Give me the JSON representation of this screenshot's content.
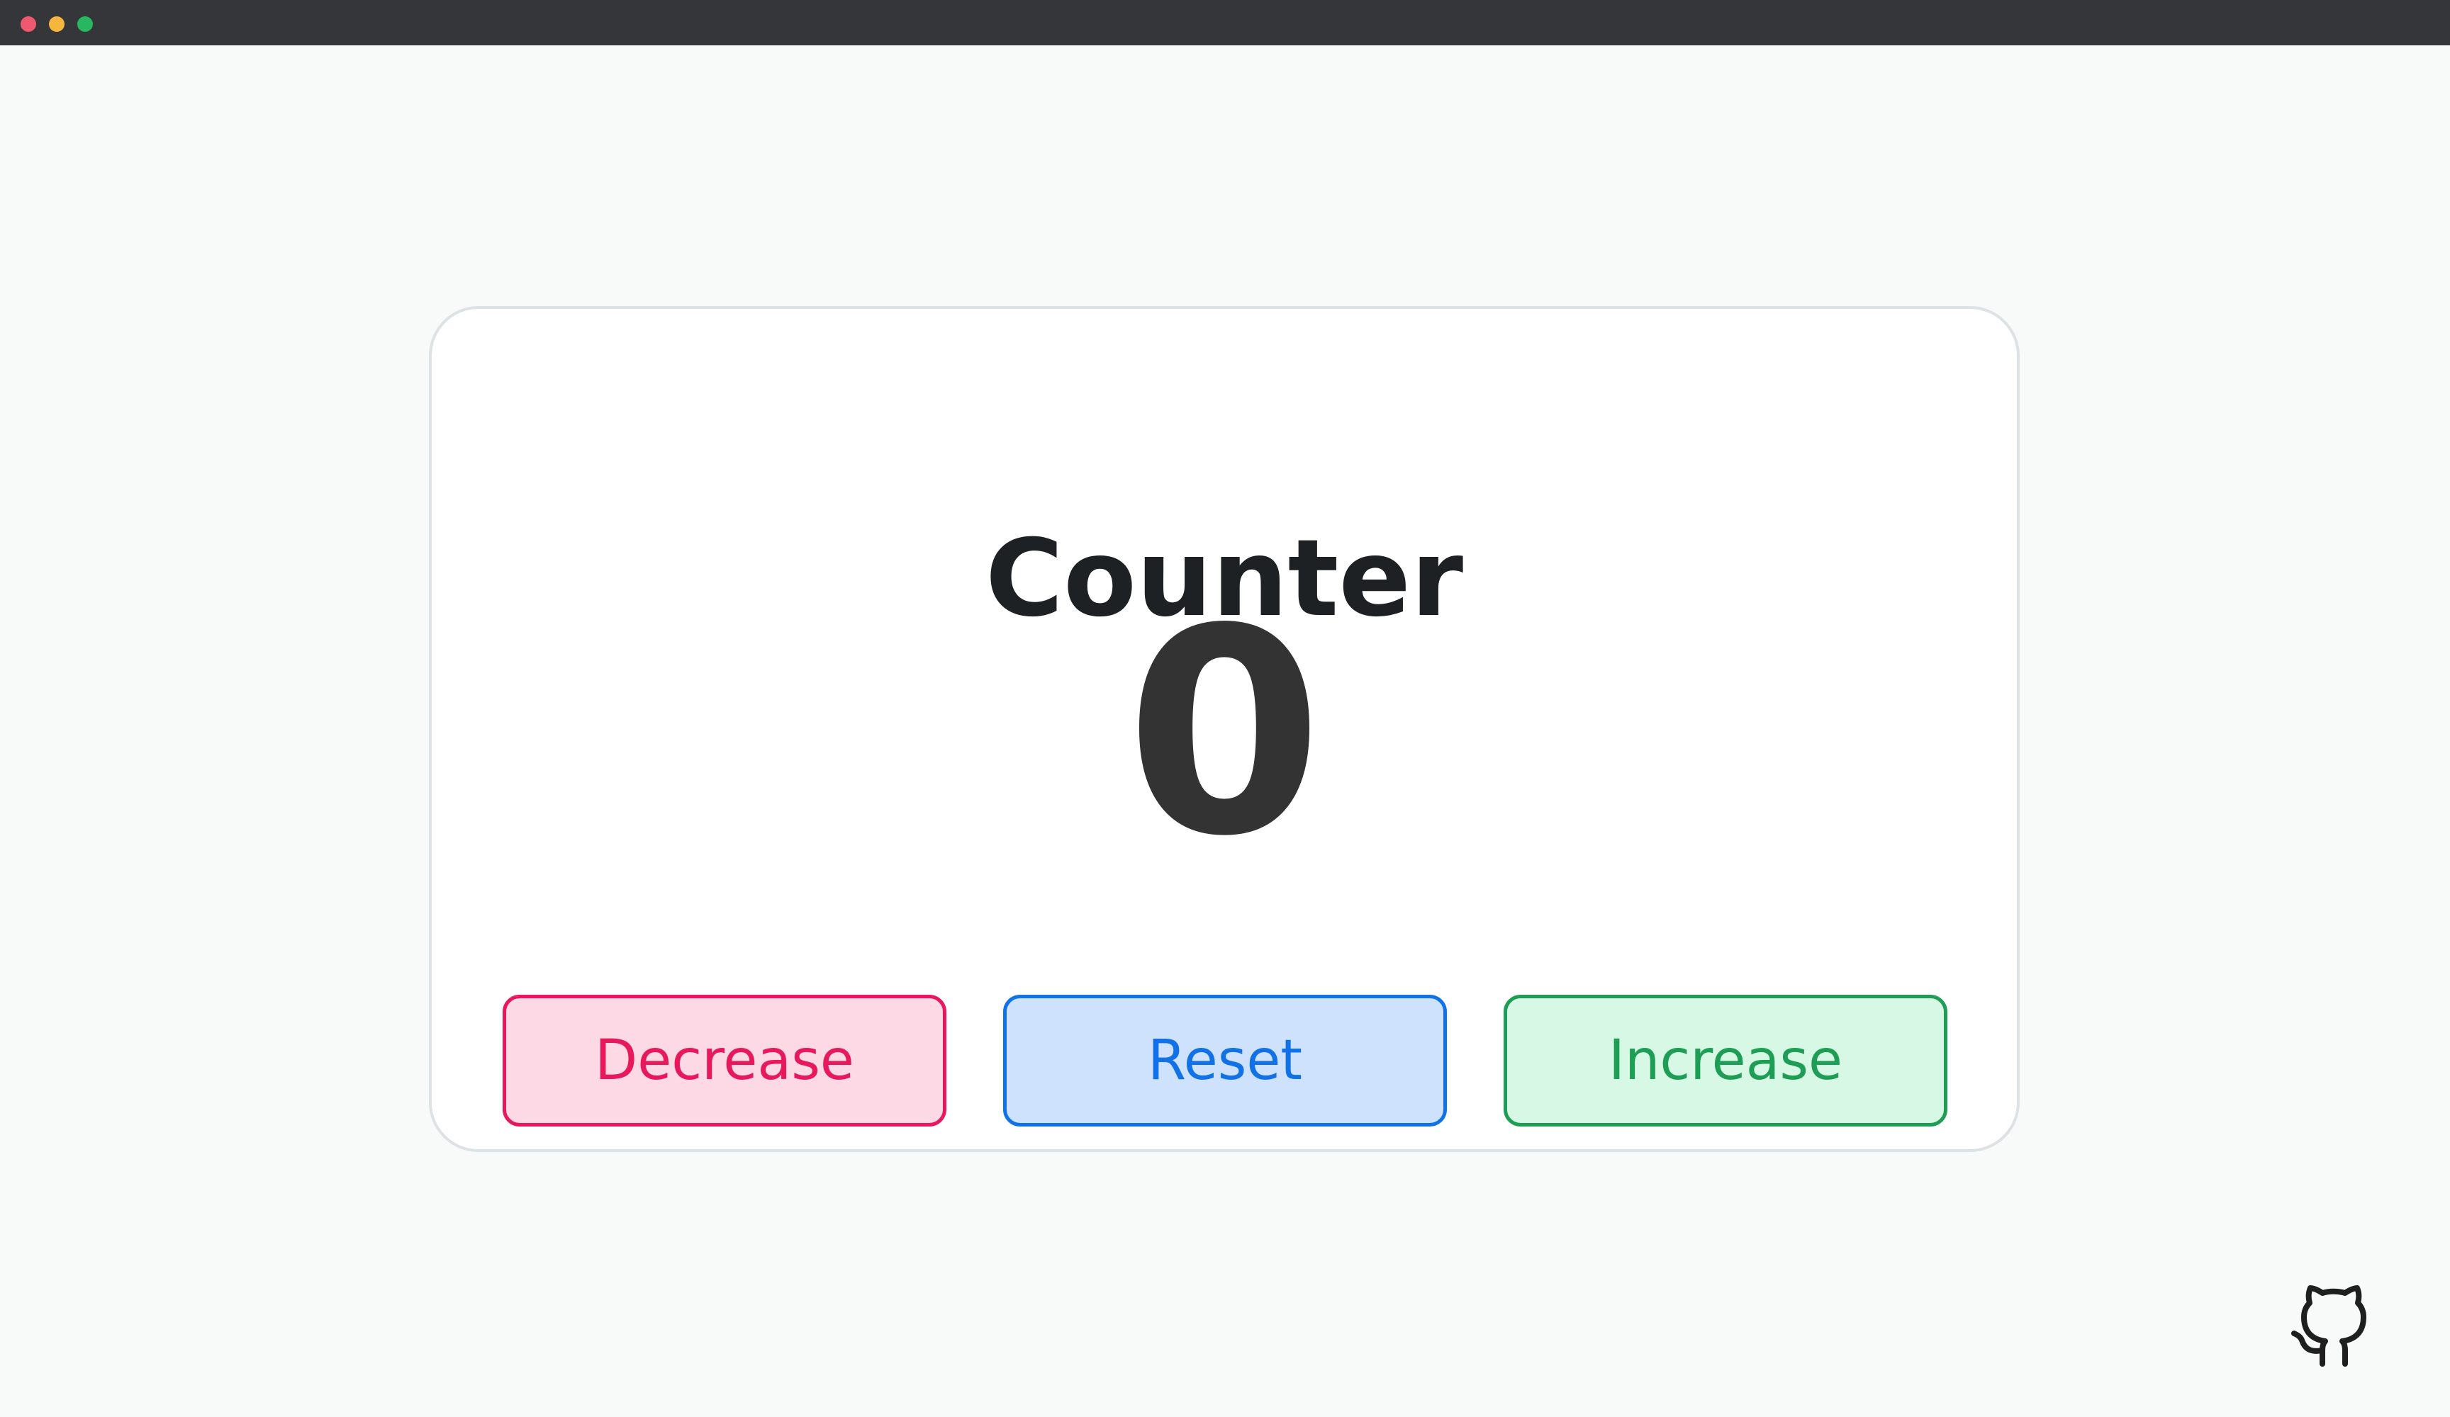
{
  "window": {
    "controls": [
      "close",
      "minimize",
      "maximize"
    ]
  },
  "counter": {
    "title": "Counter",
    "value": "0"
  },
  "buttons": {
    "decrease_label": "Decrease",
    "reset_label": "Reset",
    "increase_label": "Increase"
  },
  "footer": {
    "icon": "github-icon"
  },
  "colors": {
    "decrease": "#e8185c",
    "reset": "#1172e8",
    "increase": "#1e9e55",
    "text": "#1e2124"
  }
}
